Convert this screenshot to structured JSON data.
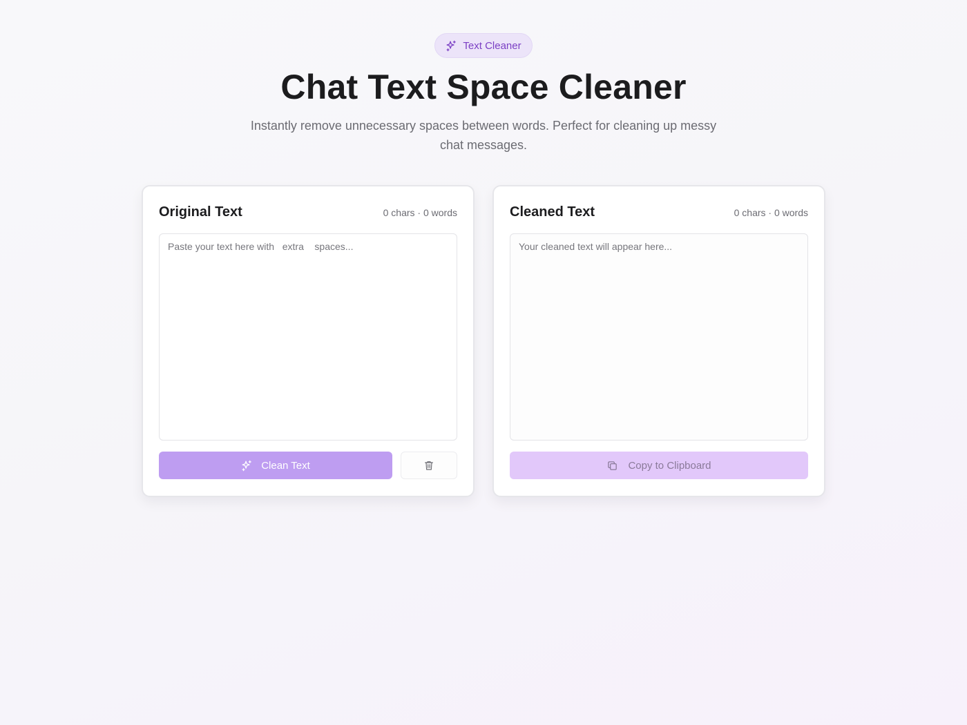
{
  "header": {
    "badge_label": "Text Cleaner",
    "title": "Chat Text Space Cleaner",
    "subtitle": "Instantly remove unnecessary spaces between words. Perfect for cleaning up messy chat messages."
  },
  "original": {
    "title": "Original Text",
    "stats": "0 chars · 0 words",
    "value": "",
    "placeholder": "Paste your text here with   extra    spaces...",
    "clean_button_label": "Clean Text"
  },
  "cleaned": {
    "title": "Cleaned Text",
    "stats": "0 chars · 0 words",
    "value": "",
    "placeholder": "Your cleaned text will appear here...",
    "copy_button_label": "Copy to Clipboard"
  },
  "icons": {
    "badge": "sparkles-icon",
    "clean_button": "sparkles-icon",
    "clear_button": "trash-icon",
    "copy_button": "copy-icon"
  },
  "colors": {
    "accent": "#7b3fc4",
    "badge_bg": "#ece4f9",
    "primary_button": "#be9df1",
    "copy_button": "#e2c8fa"
  }
}
